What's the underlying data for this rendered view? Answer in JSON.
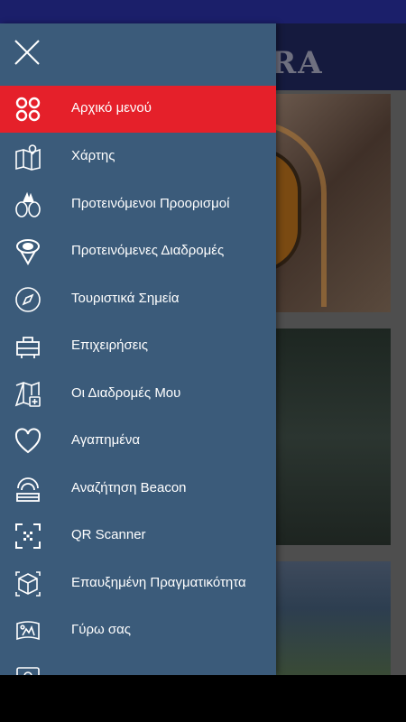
{
  "background": {
    "title": "RA"
  },
  "menu": {
    "items": [
      {
        "label": "Αρχικό μενού",
        "icon": "grid-icon",
        "active": true
      },
      {
        "label": "Χάρτης",
        "icon": "map-icon",
        "active": false
      },
      {
        "label": "Προτεινόμενοι Προορισμοί",
        "icon": "destinations-icon",
        "active": false
      },
      {
        "label": "Προτεινόμενες Διαδρομές",
        "icon": "routes-icon",
        "active": false
      },
      {
        "label": "Τουριστικά Σημεία",
        "icon": "compass-icon",
        "active": false
      },
      {
        "label": "Επιχειρήσεις",
        "icon": "business-icon",
        "active": false
      },
      {
        "label": "Οι Διαδρομές Μου",
        "icon": "my-routes-icon",
        "active": false
      },
      {
        "label": "Αγαπημένα",
        "icon": "heart-icon",
        "active": false
      },
      {
        "label": "Αναζήτηση Beacon",
        "icon": "beacon-icon",
        "active": false
      },
      {
        "label": "QR Scanner",
        "icon": "qr-scanner-icon",
        "active": false
      },
      {
        "label": "Επαυξημένη Πραγματικότητα",
        "icon": "augmented-reality-icon",
        "active": false
      },
      {
        "label": "Γύρω σας",
        "icon": "around-you-icon",
        "active": false
      },
      {
        "label": "",
        "icon": "profile-icon",
        "active": false
      }
    ]
  },
  "colors": {
    "drawer": "#3b5b7a",
    "active": "#e5202a",
    "status_bar": "#1b1f6a"
  }
}
